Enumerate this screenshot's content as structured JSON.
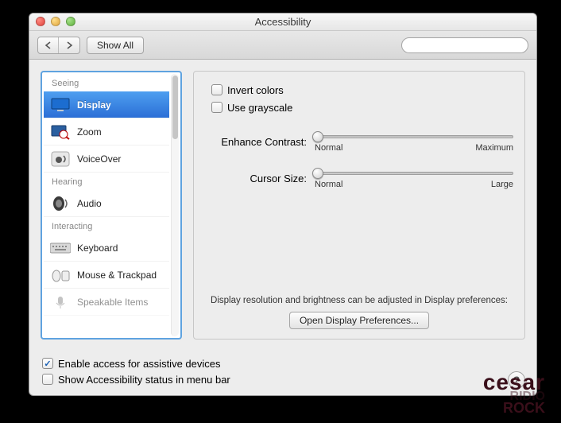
{
  "window": {
    "title": "Accessibility"
  },
  "toolbar": {
    "show_all": "Show All",
    "search_placeholder": ""
  },
  "sidebar": {
    "groups": {
      "seeing": "Seeing",
      "hearing": "Hearing",
      "interacting": "Interacting"
    },
    "items": {
      "display": "Display",
      "zoom": "Zoom",
      "voiceover": "VoiceOver",
      "audio": "Audio",
      "keyboard": "Keyboard",
      "mouse_trackpad": "Mouse & Trackpad",
      "speakable": "Speakable Items"
    }
  },
  "panel": {
    "invert_colors": "Invert colors",
    "use_grayscale": "Use grayscale",
    "enhance_contrast_label": "Enhance Contrast:",
    "contrast_min": "Normal",
    "contrast_max": "Maximum",
    "cursor_size_label": "Cursor Size:",
    "cursor_min": "Normal",
    "cursor_max": "Large",
    "hint": "Display resolution and brightness can be adjusted in Display preferences:",
    "open_display_prefs": "Open Display Preferences..."
  },
  "footer": {
    "enable_assistive": "Enable access for assistive devices",
    "show_status_menubar": "Show Accessibility status in menu bar"
  },
  "watermark": {
    "l1": "cesar",
    "l2": "RIDIO",
    "l3": "ROCK"
  }
}
